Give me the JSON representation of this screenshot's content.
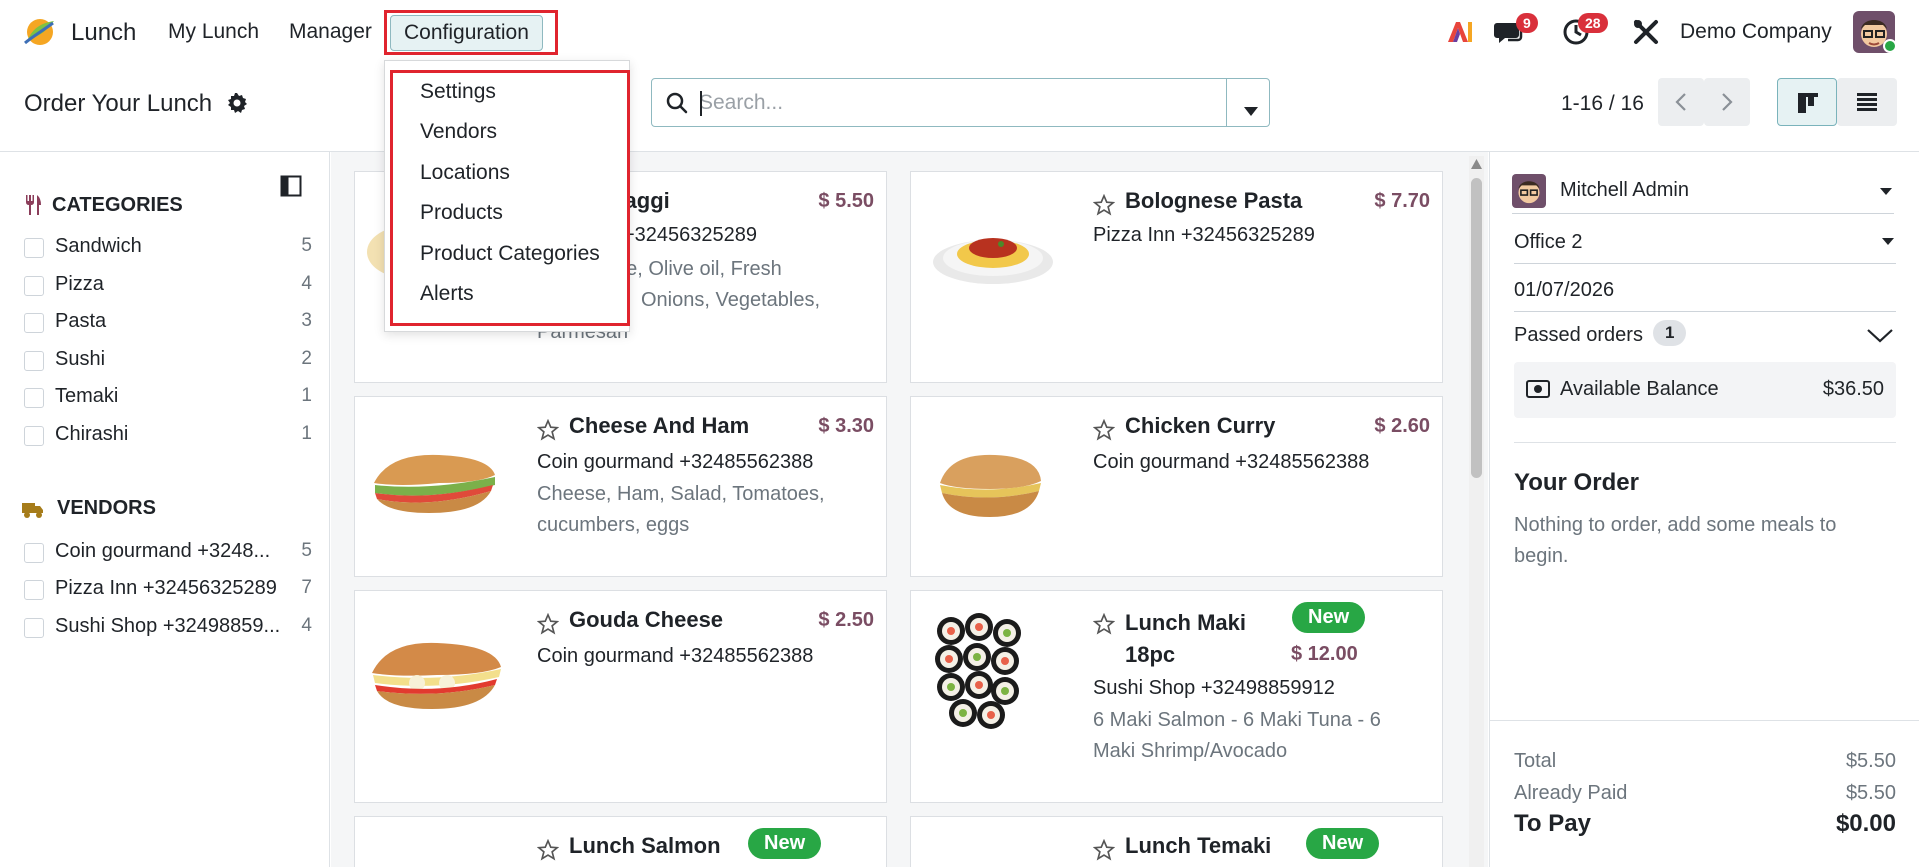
{
  "nav": {
    "app_name": "Lunch",
    "menu": [
      "My Lunch",
      "Manager",
      "Configuration"
    ],
    "messages_count": "9",
    "activities_count": "28",
    "ai_label": "AI",
    "company": "Demo Company"
  },
  "control": {
    "title": "Order Your Lunch",
    "search_placeholder": "Search...",
    "pager": "1-16 / 16"
  },
  "config_menu": {
    "items": [
      "Settings",
      "Vendors",
      "Locations",
      "Products",
      "Product Categories",
      "Alerts"
    ]
  },
  "sidebar": {
    "categories_title": "CATEGORIES",
    "categories": [
      {
        "label": "Sandwich",
        "count": "5"
      },
      {
        "label": "Pizza",
        "count": "4"
      },
      {
        "label": "Pasta",
        "count": "3"
      },
      {
        "label": "Sushi",
        "count": "2"
      },
      {
        "label": "Temaki",
        "count": "1"
      },
      {
        "label": "Chirashi",
        "count": "1"
      }
    ],
    "vendors_title": "VENDORS",
    "vendors": [
      {
        "label": "Coin gourmand +3248...",
        "count": "5"
      },
      {
        "label": "Pizza Inn +32456325289",
        "count": "7"
      },
      {
        "label": "Sushi Shop +32498859...",
        "count": "4"
      }
    ]
  },
  "products": [
    {
      "name": "maggi",
      "price": "$ 5.50",
      "vendor": "+32456325289",
      "desc1": "uce, Olive oil, Fresh",
      "desc2": "Onions, Vegetables,",
      "desc3": "Parmesan"
    },
    {
      "name": "Bolognese Pasta",
      "price": "$ 7.70",
      "vendor": "Pizza Inn +32456325289"
    },
    {
      "name": "Cheese And Ham",
      "price": "$ 3.30",
      "vendor": "Coin gourmand +32485562388",
      "desc": "Cheese, Ham, Salad, Tomatoes, cucumbers, eggs"
    },
    {
      "name": "Chicken Curry",
      "price": "$ 2.60",
      "vendor": "Coin gourmand +32485562388"
    },
    {
      "name": "Gouda Cheese",
      "price": "$ 2.50",
      "vendor": "Coin gourmand +32485562388"
    },
    {
      "name": "Lunch Maki 18pc",
      "price": "$ 12.00",
      "badge": "New",
      "vendor": "Sushi Shop +32498859912",
      "desc": "6 Maki Salmon - 6 Maki Tuna - 6 Maki Shrimp/Avocado"
    },
    {
      "name": "Lunch Salmon",
      "badge": "New"
    },
    {
      "name": "Lunch Temaki",
      "badge": "New"
    }
  ],
  "panel": {
    "user": "Mitchell Admin",
    "location": "Office 2",
    "date": "01/07/2026",
    "passed_orders_label": "Passed orders",
    "passed_orders_count": "1",
    "balance_label": "Available Balance",
    "balance_value": "$36.50",
    "order_title": "Your Order",
    "order_empty": "Nothing to order, add some meals to begin.",
    "total_label": "Total",
    "total_value": "$5.50",
    "paid_label": "Already Paid",
    "paid_value": "$5.50",
    "topay_label": "To Pay",
    "topay_value": "$0.00"
  },
  "colors": {
    "accent": "#017e84",
    "price": "#7a4d63",
    "badge_red": "#d9303b",
    "new_green": "#28a745",
    "highlight": "#e0242e"
  }
}
